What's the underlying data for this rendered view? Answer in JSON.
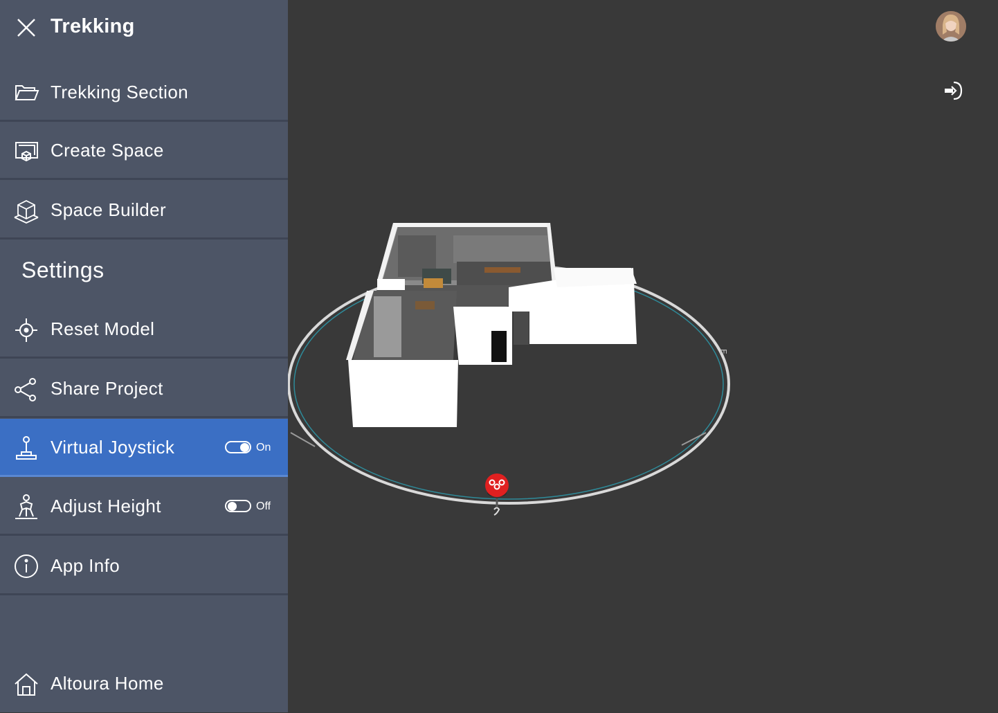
{
  "header": {
    "title": "Trekking",
    "close_icon": "close-icon"
  },
  "menu": {
    "items": [
      {
        "label": "Trekking Section",
        "icon": "folder-open-icon"
      },
      {
        "label": "Create Space",
        "icon": "create-space-icon"
      },
      {
        "label": "Space Builder",
        "icon": "cube-icon"
      }
    ],
    "settings_title": "Settings",
    "settings_items": [
      {
        "label": "Reset Model",
        "icon": "crosshair-icon"
      },
      {
        "label": "Share Project",
        "icon": "share-icon"
      },
      {
        "label": "Virtual Joystick",
        "icon": "joystick-icon",
        "toggle": "On"
      },
      {
        "label": "Adjust Height",
        "icon": "person-height-icon",
        "toggle": "Off"
      },
      {
        "label": "App Info",
        "icon": "info-icon"
      }
    ],
    "home": {
      "label": "Altoura Home",
      "icon": "home-icon"
    }
  },
  "colors": {
    "sidebar_bg": "#4d5566",
    "active_bg": "#3b6fc4",
    "viewport_bg": "#393939",
    "pin_red": "#e02020"
  },
  "viewport": {
    "avatar_icon": "user-avatar",
    "exit_icon": "exit-icon",
    "compass_mark": "E",
    "pin_icon": "location-pin-icon"
  }
}
